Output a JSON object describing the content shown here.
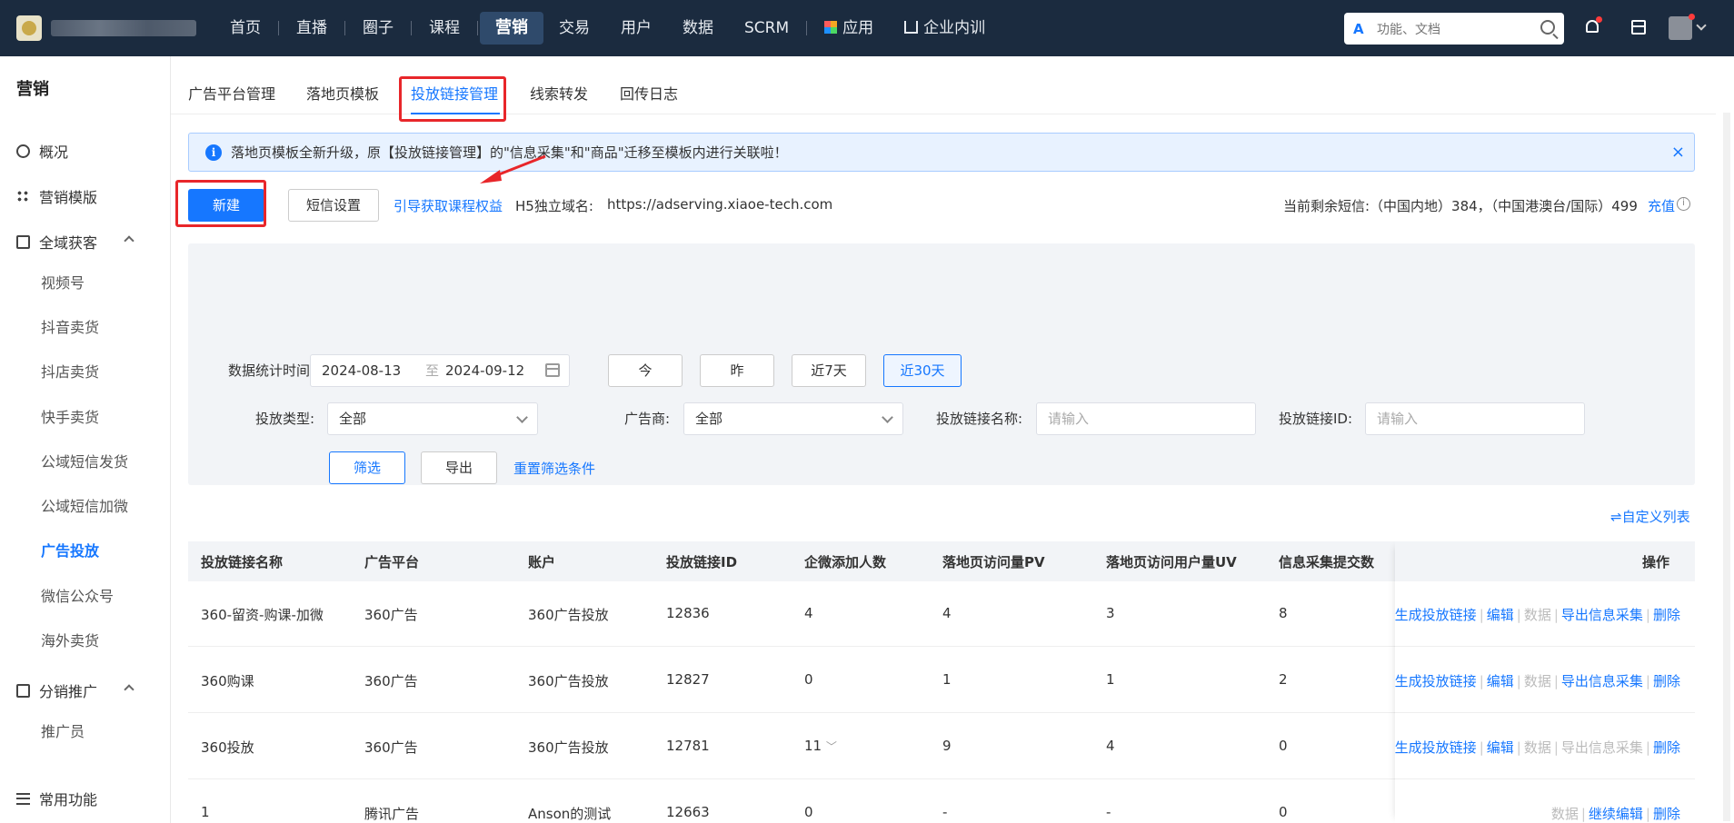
{
  "topbar": {
    "nav": [
      "首页",
      "直播",
      "圈子",
      "课程",
      "营销",
      "交易",
      "用户",
      "数据",
      "SCRM",
      "应用",
      "企业内训"
    ],
    "active_nav": "营销",
    "search_placeholder": "功能、文档"
  },
  "sidebar": {
    "title": "营销",
    "items": {
      "overview": "概况",
      "template": "营销模版",
      "acquire": "全域获客",
      "distribution": "分销推广",
      "common": "常用功能"
    },
    "acquire_subs": [
      "视频号",
      "抖音卖货",
      "抖店卖货",
      "快手卖货",
      "公域短信发货",
      "公域短信加微",
      "广告投放",
      "微信公众号",
      "海外卖货"
    ],
    "distribution_subs": [
      "推广员"
    ]
  },
  "tabs": [
    "广告平台管理",
    "落地页模板",
    "投放链接管理",
    "线索转发",
    "回传日志"
  ],
  "active_tab": "投放链接管理",
  "notice": "落地页模板全新升级，原【投放链接管理】的\"信息采集\"和\"商品\"迁移至模板内进行关联啦！",
  "toolbar": {
    "new": "新建",
    "sms_settings": "短信设置",
    "guide_link": "引导获取课程权益",
    "domain_label": "H5独立域名:",
    "domain_value": "https://adserving.xiaoe-tech.com",
    "sms_remaining": "当前剩余短信:（中国内地）384，（中国港澳台/国际）499",
    "recharge": "充值"
  },
  "filters": {
    "date_label": "数据统计时间:",
    "date_start": "2024-08-13",
    "date_to": "至",
    "date_end": "2024-09-12",
    "quick": [
      "今",
      "昨",
      "近7天",
      "近30天"
    ],
    "quick_selected": "近30天",
    "type_label": "投放类型:",
    "type_value": "全部",
    "advertiser_label": "广告商:",
    "advertiser_value": "全部",
    "name_label": "投放链接名称:",
    "name_placeholder": "请输入",
    "id_label": "投放链接ID:",
    "id_placeholder": "请输入",
    "filter_btn": "筛选",
    "export_btn": "导出",
    "reset_link": "重置筛选条件"
  },
  "custom_columns": "自定义列表",
  "table": {
    "headers": [
      "投放链接名称",
      "广告平台",
      "账户",
      "投放链接ID",
      "企微添加人数",
      "落地页访问量PV",
      "落地页访问用户量UV",
      "信息采集提交数",
      "操作"
    ],
    "rows": [
      {
        "name": "360-留资-购课-加微",
        "platform": "360广告",
        "account": "360广告投放",
        "id": "12836",
        "wecom": "4",
        "pv": "4",
        "uv": "3",
        "collect": "8",
        "ops": [
          "生成投放链接",
          "编辑",
          "数据",
          "导出信息采集",
          "删除"
        ]
      },
      {
        "name": "360购课",
        "platform": "360广告",
        "account": "360广告投放",
        "id": "12827",
        "wecom": "0",
        "pv": "1",
        "uv": "1",
        "collect": "2",
        "ops": [
          "生成投放链接",
          "编辑",
          "数据",
          "导出信息采集",
          "删除"
        ]
      },
      {
        "name": "360投放",
        "platform": "360广告",
        "account": "360广告投放",
        "id": "12781",
        "wecom": "11",
        "pv": "9",
        "uv": "4",
        "collect": "0",
        "ops": [
          "生成投放链接",
          "编辑",
          "数据",
          "导出信息采集",
          "删除"
        ]
      },
      {
        "name": "1",
        "platform": "腾讯广告",
        "account": "Anson的测试",
        "id": "12663",
        "wecom": "0",
        "pv": "-",
        "uv": "-",
        "collect": "0",
        "ops": [
          "数据",
          "继续编辑",
          "删除"
        ]
      }
    ]
  }
}
